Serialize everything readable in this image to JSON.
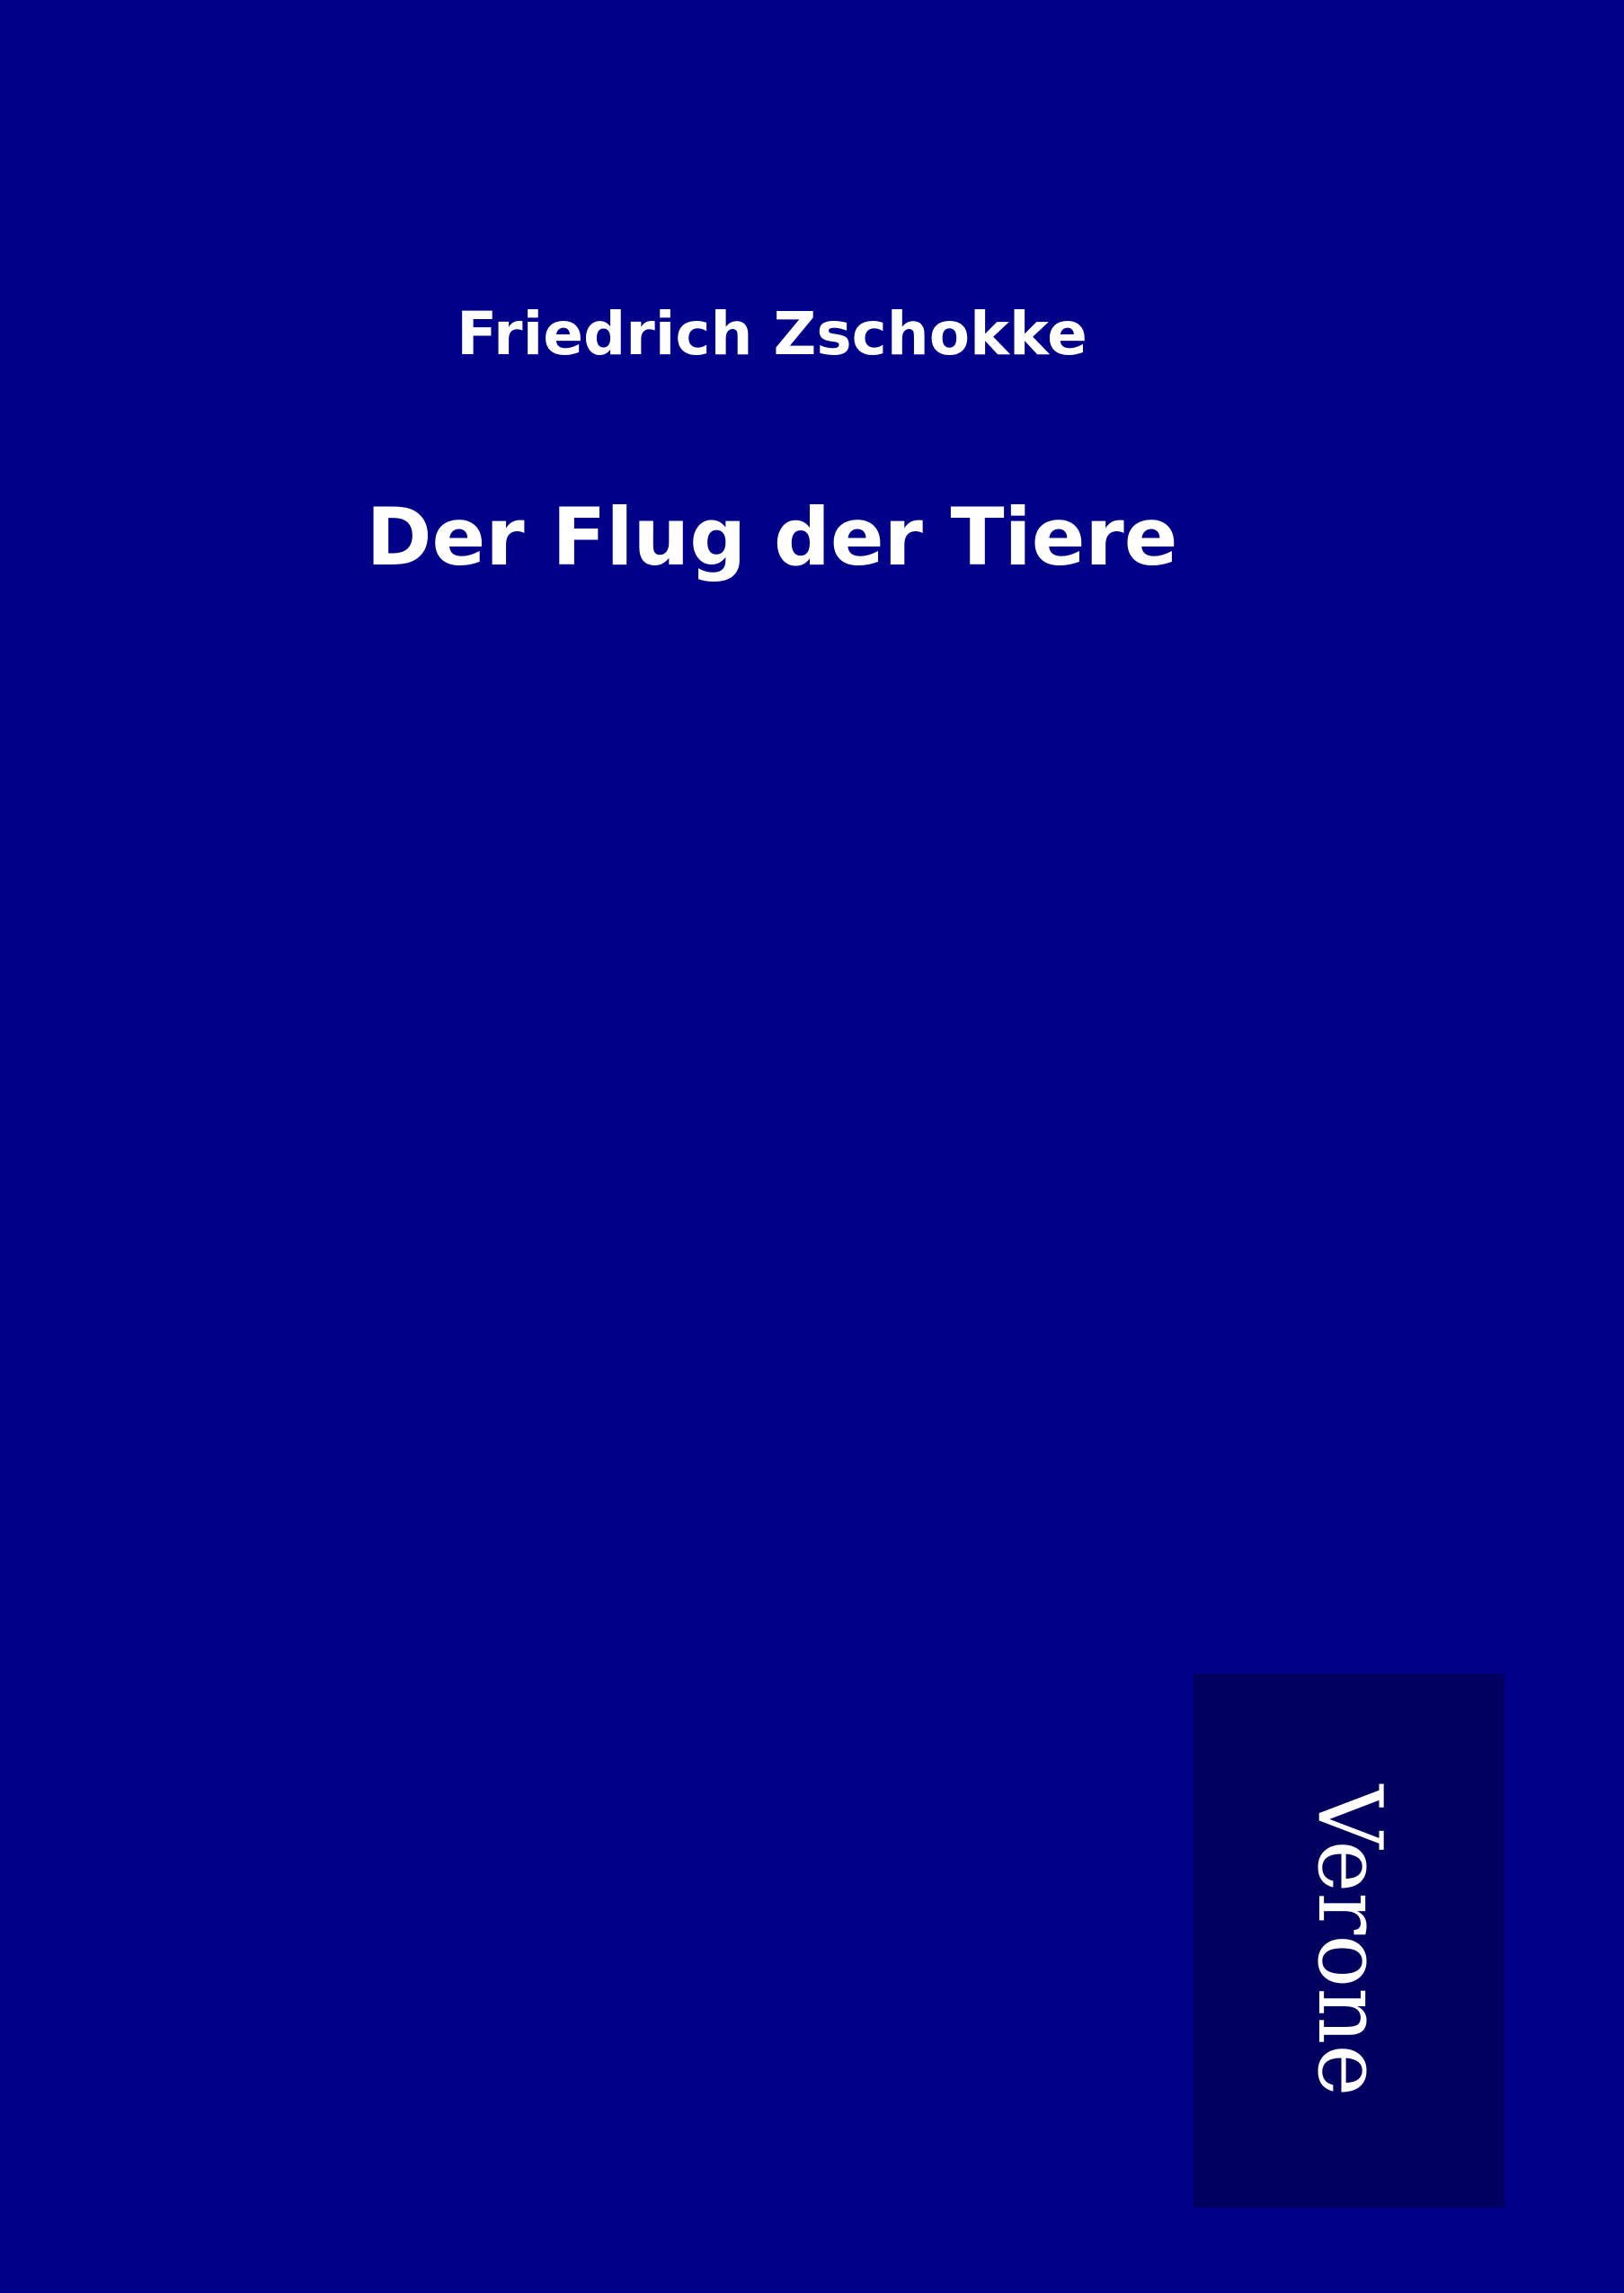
{
  "cover": {
    "author": "Friedrich Zschokke",
    "title": "Der Flug der Tiere",
    "publisher": "Verone"
  },
  "colors": {
    "background": "#000088",
    "publisher_panel": "#00005e",
    "text": "#ffffff"
  }
}
